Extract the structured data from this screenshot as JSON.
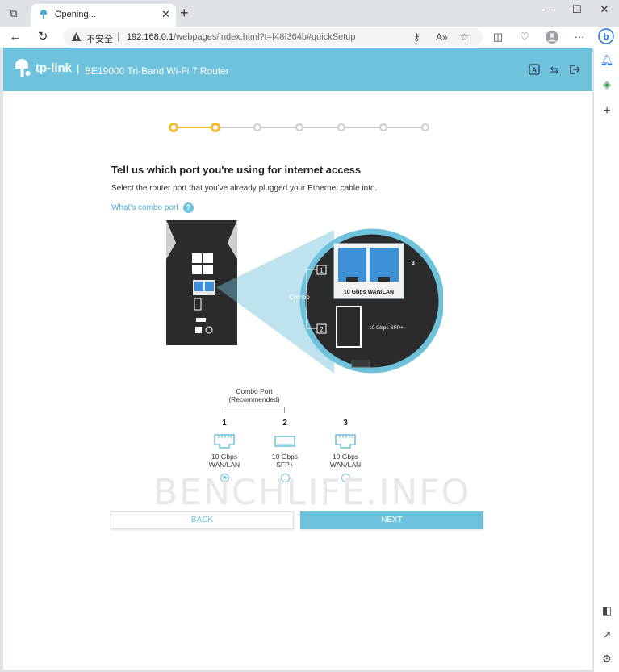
{
  "browser": {
    "tab_title": "Opening...",
    "address_security": "不安全",
    "url_host": "192.168.0.1",
    "url_path": "/webpages/index.html?t=f48f364b#quickSetup"
  },
  "header": {
    "brand": "tp-link",
    "separator": "|",
    "model": "BE19000 Tri-Band Wi-Fi 7 Router"
  },
  "progress": {
    "total_steps": 7,
    "current_step": 2
  },
  "main": {
    "title": "Tell us which port you're using for internet access",
    "subtitle": "Select the router port that you've already plugged your Ethernet cable into.",
    "combo_link": "What's combo port",
    "help_glyph": "?"
  },
  "router_image": {
    "combo_label": "Combo",
    "port1_num": "1",
    "port2_num": "2",
    "port3_num": "3",
    "wan_lan_label": "10 Gbps WAN/LAN",
    "sfp_label": "10 Gbps SFP+"
  },
  "port_selection": {
    "combo_title_line1": "Combo Port",
    "combo_title_line2": "(Recommended)",
    "options": [
      {
        "number": "1",
        "line1": "10 Gbps",
        "line2": "WAN/LAN",
        "icon": "ethernet-port-icon",
        "selected": true
      },
      {
        "number": "2",
        "line1": "10 Gbps",
        "line2": "SFP+",
        "icon": "sfp-port-icon",
        "selected": false
      },
      {
        "number": "3",
        "line1": "10 Gbps",
        "line2": "WAN/LAN",
        "icon": "ethernet-port-icon",
        "selected": false
      }
    ]
  },
  "watermark": "BENCHLIFE.INFO",
  "buttons": {
    "back": "BACK",
    "next": "NEXT"
  },
  "colors": {
    "accent": "#6ec2dc",
    "progress_done": "#f5bd2c",
    "progress_todo": "#c9ccd0"
  }
}
